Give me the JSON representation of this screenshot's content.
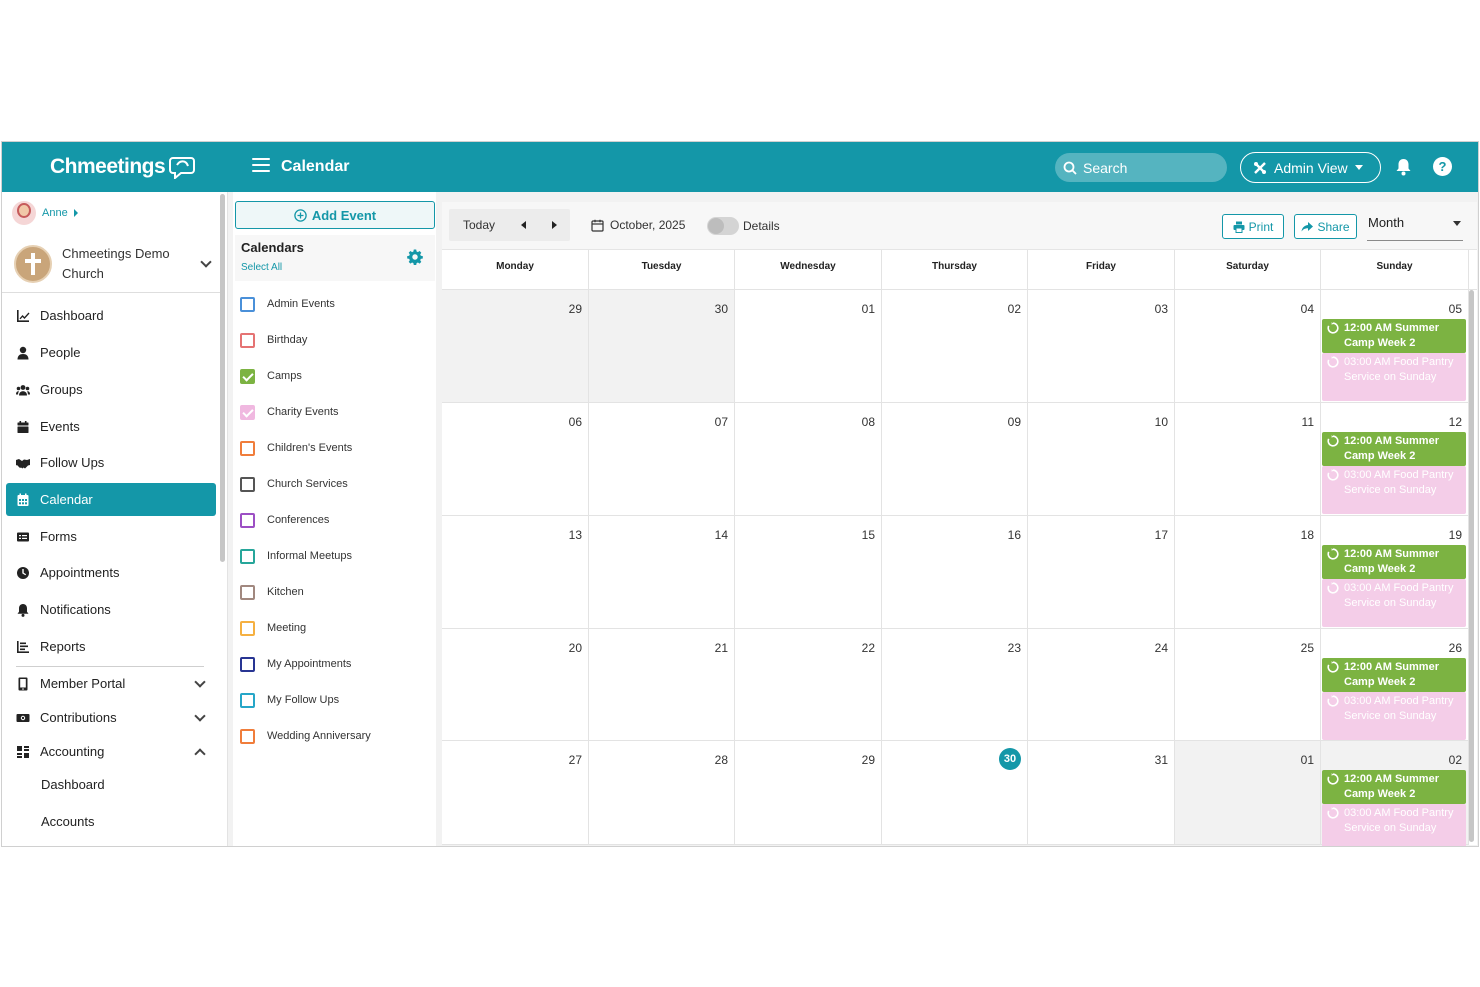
{
  "app": {
    "logo": "Chmeetings",
    "page_title": "Calendar",
    "search_label": "Search",
    "admin_view_label": "Admin View",
    "help_label": "?",
    "brand_color": "#1497a8"
  },
  "sidebar": {
    "user_name": "Anne",
    "church_name": "Chmeetings Demo Church",
    "items": [
      {
        "label": "Dashboard",
        "icon": "chart-line-icon"
      },
      {
        "label": "People",
        "icon": "person-icon"
      },
      {
        "label": "Groups",
        "icon": "users-icon"
      },
      {
        "label": "Events",
        "icon": "calendar-icon"
      },
      {
        "label": "Follow Ups",
        "icon": "handshake-icon"
      },
      {
        "label": "Calendar",
        "icon": "calendar-grid-icon",
        "active": true
      },
      {
        "label": "Forms",
        "icon": "form-icon"
      },
      {
        "label": "Appointments",
        "icon": "clock-icon"
      },
      {
        "label": "Notifications",
        "icon": "bell-icon"
      },
      {
        "label": "Reports",
        "icon": "report-icon"
      },
      {
        "label": "Member Portal",
        "icon": "phone-icon"
      },
      {
        "label": "Contributions",
        "icon": "money-icon"
      },
      {
        "label": "Accounting",
        "icon": "grid-icon"
      }
    ],
    "accounting_sub": [
      "Dashboard",
      "Accounts"
    ]
  },
  "calendars": {
    "add_event_label": "Add Event",
    "title": "Calendars",
    "select_all": "Select All",
    "items": [
      {
        "label": "Admin Events",
        "color": "#4a90d9",
        "checked": false
      },
      {
        "label": "Birthday",
        "color": "#e57373",
        "checked": false
      },
      {
        "label": "Camps",
        "color": "#7cb342",
        "checked": true
      },
      {
        "label": "Charity Events",
        "color": "#f0b8e0",
        "checked": true
      },
      {
        "label": "Children's Events",
        "color": "#f07d3b",
        "checked": false
      },
      {
        "label": "Church Services",
        "color": "#555555",
        "checked": false
      },
      {
        "label": "Conferences",
        "color": "#9c4fc4",
        "checked": false
      },
      {
        "label": "Informal Meetups",
        "color": "#26a69a",
        "checked": false
      },
      {
        "label": "Kitchen",
        "color": "#a1887f",
        "checked": false
      },
      {
        "label": "Meeting",
        "color": "#f5b041",
        "checked": false
      },
      {
        "label": "My Appointments",
        "color": "#283593",
        "checked": false
      },
      {
        "label": "My Follow Ups",
        "color": "#26a6c8",
        "checked": false
      },
      {
        "label": "Wedding Anniversary",
        "color": "#f07d3b",
        "checked": false
      }
    ]
  },
  "toolbar": {
    "today_label": "Today",
    "date_label": "October, 2025",
    "details_label": "Details",
    "print_label": "Print",
    "share_label": "Share",
    "view_label": "Month"
  },
  "calendar": {
    "weekdays": [
      "Monday",
      "Tuesday",
      "Wednesday",
      "Thursday",
      "Friday",
      "Saturday",
      "Sunday"
    ],
    "weeks": [
      [
        {
          "d": "29",
          "other": true
        },
        {
          "d": "30",
          "other": true
        },
        {
          "d": "01"
        },
        {
          "d": "02"
        },
        {
          "d": "03"
        },
        {
          "d": "04"
        },
        {
          "d": "05",
          "events": true
        }
      ],
      [
        {
          "d": "06"
        },
        {
          "d": "07"
        },
        {
          "d": "08"
        },
        {
          "d": "09"
        },
        {
          "d": "10"
        },
        {
          "d": "11"
        },
        {
          "d": "12",
          "events": true
        }
      ],
      [
        {
          "d": "13"
        },
        {
          "d": "14"
        },
        {
          "d": "15"
        },
        {
          "d": "16"
        },
        {
          "d": "17"
        },
        {
          "d": "18"
        },
        {
          "d": "19",
          "events": true
        }
      ],
      [
        {
          "d": "20"
        },
        {
          "d": "21"
        },
        {
          "d": "22"
        },
        {
          "d": "23"
        },
        {
          "d": "24"
        },
        {
          "d": "25"
        },
        {
          "d": "26",
          "events": true
        }
      ],
      [
        {
          "d": "27"
        },
        {
          "d": "28"
        },
        {
          "d": "29"
        },
        {
          "d": "30",
          "today": true
        },
        {
          "d": "31"
        },
        {
          "d": "01",
          "other": true
        },
        {
          "d": "02",
          "events": true,
          "other": true
        }
      ]
    ],
    "event_camp": {
      "time": "12:00 AM",
      "title": "Summer Camp Week 2",
      "color": "#7cb342"
    },
    "event_food": {
      "time": "03:00 AM",
      "title": "Food Pantry Service on Sunday",
      "color": "#f4cde8"
    }
  }
}
